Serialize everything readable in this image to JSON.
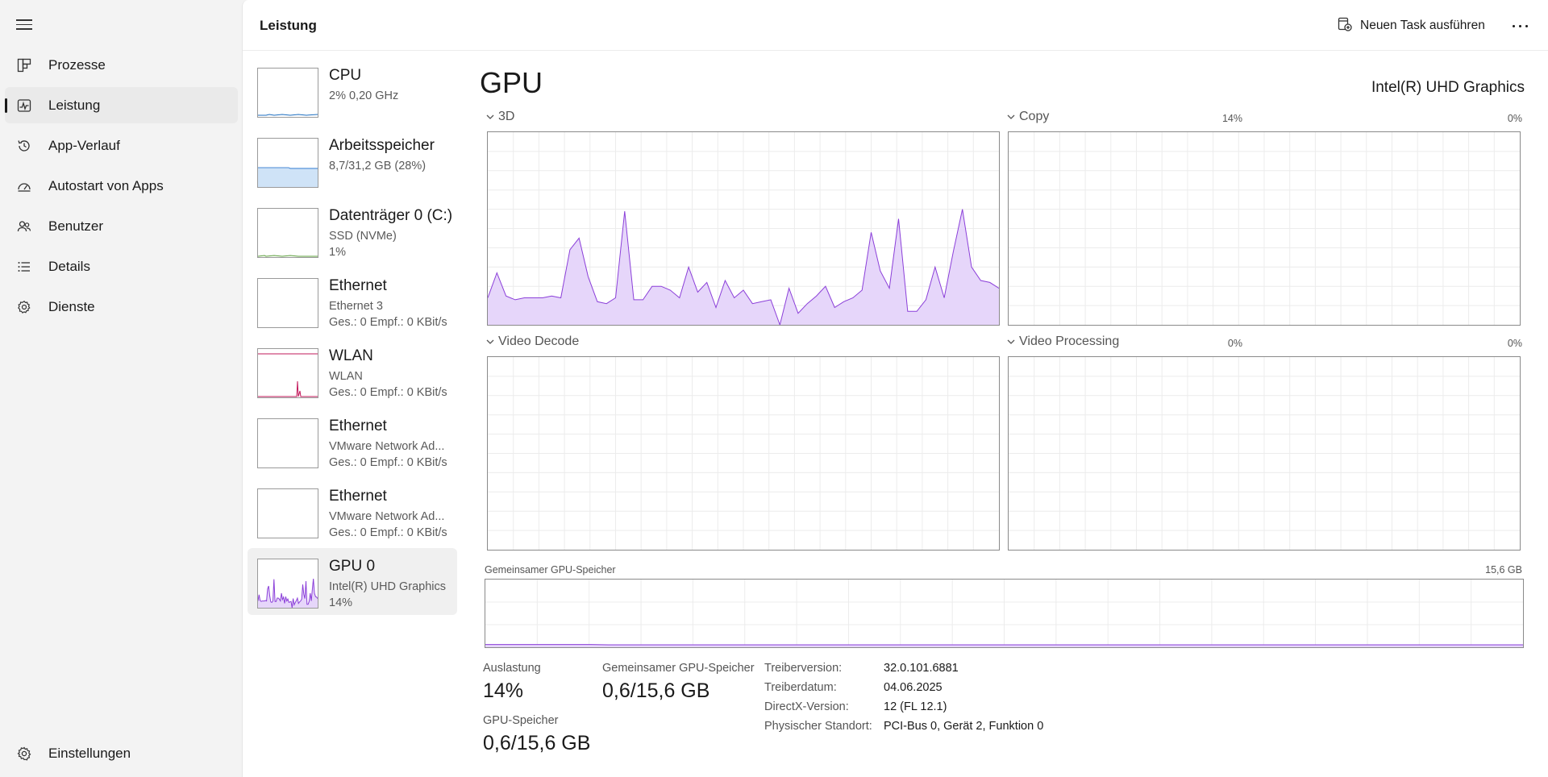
{
  "nav": {
    "items": [
      {
        "label": "Prozesse",
        "icon": "processes-icon"
      },
      {
        "label": "Leistung",
        "icon": "performance-icon",
        "active": true
      },
      {
        "label": "App-Verlauf",
        "icon": "history-icon"
      },
      {
        "label": "Autostart von Apps",
        "icon": "startup-icon"
      },
      {
        "label": "Benutzer",
        "icon": "users-icon"
      },
      {
        "label": "Details",
        "icon": "details-list-icon"
      },
      {
        "label": "Dienste",
        "icon": "services-icon"
      }
    ],
    "settings_label": "Einstellungen"
  },
  "header": {
    "title": "Leistung",
    "run_task_label": "Neuen Task ausführen"
  },
  "devices": [
    {
      "title": "CPU",
      "line2": "2%  0,20 GHz",
      "line3": ""
    },
    {
      "title": "Arbeitsspeicher",
      "line2": "8,7/31,2 GB (28%)",
      "line3": ""
    },
    {
      "title": "Datenträger 0 (C:)",
      "line2": "SSD (NVMe)",
      "line3": "1%"
    },
    {
      "title": "Ethernet",
      "line2": "Ethernet 3",
      "line3": "Ges.: 0 Empf.: 0 KBit/s"
    },
    {
      "title": "WLAN",
      "line2": "WLAN",
      "line3": "Ges.: 0 Empf.: 0 KBit/s"
    },
    {
      "title": "Ethernet",
      "line2": "VMware Network Ad...",
      "line3": "Ges.: 0 Empf.: 0 KBit/s"
    },
    {
      "title": "Ethernet",
      "line2": "VMware Network Ad...",
      "line3": "Ges.: 0 Empf.: 0 KBit/s"
    },
    {
      "title": "GPU 0",
      "line2": "Intel(R) UHD Graphics",
      "line3": "14%"
    }
  ],
  "gpu": {
    "title": "GPU",
    "name": "Intel(R) UHD Graphics",
    "engines": [
      {
        "label": "3D",
        "percent": "14%"
      },
      {
        "label": "Copy",
        "percent": "0%"
      },
      {
        "label": "Video Decode",
        "percent": "0%"
      },
      {
        "label": "Video Processing",
        "percent": "0%"
      }
    ],
    "shared_memory_label": "Gemeinsamer GPU-Speicher",
    "shared_memory_max": "15,6 GB",
    "usage_3d_history": [
      14,
      27,
      15,
      13,
      14,
      14,
      14,
      15,
      14,
      39,
      45,
      25,
      12,
      11,
      14,
      59,
      13,
      13,
      20,
      20,
      18,
      14,
      30,
      17,
      22,
      9,
      23,
      14,
      18,
      11,
      12,
      13,
      0,
      19,
      6,
      11,
      15,
      20,
      9,
      12,
      14,
      18,
      48,
      28,
      19,
      55,
      7,
      7,
      13,
      30,
      14,
      38,
      60,
      30,
      23,
      22,
      19
    ],
    "stats": {
      "usage_label": "Auslastung",
      "usage_value": "14%",
      "shared_label": "Gemeinsamer GPU-Speicher",
      "shared_value": "0,6/15,6 GB",
      "gpu_mem_label": "GPU-Speicher",
      "gpu_mem_value": "0,6/15,6 GB"
    },
    "info": [
      {
        "key": "Treiberversion:",
        "value": "32.0.101.6881"
      },
      {
        "key": "Treiberdatum:",
        "value": "04.06.2025"
      },
      {
        "key": "DirectX-Version:",
        "value": "12 (FL 12.1)"
      },
      {
        "key": "Physischer Standort:",
        "value": "PCI-Bus 0, Gerät 2, Funktion 0"
      }
    ]
  },
  "colors": {
    "gpu_line": "#8b3fd9",
    "gpu_fill": "#e6d6fa",
    "memory_fill": "#cfe3f7",
    "memory_line": "#4a8ad6",
    "wlan_line": "#c2185b",
    "cpu_line": "#1e6fc0"
  }
}
